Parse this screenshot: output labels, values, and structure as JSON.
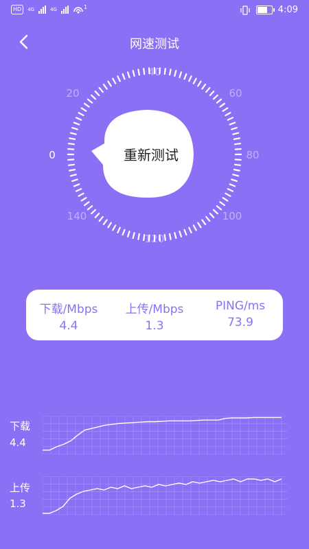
{
  "status": {
    "left_chip": "HD",
    "net1": "4G",
    "net2": "4G",
    "wifi_sup": "1",
    "time": "4:09"
  },
  "header": {
    "title": "网速测试"
  },
  "gauge": {
    "ticks": [
      "0",
      "20",
      "40",
      "60",
      "80",
      "100",
      "120",
      "140"
    ],
    "button_label": "重新测试"
  },
  "results": {
    "download": {
      "label": "下载/Mbps",
      "value": "4.4"
    },
    "upload": {
      "label": "上传/Mbps",
      "value": "1.3"
    },
    "ping": {
      "label": "PING/ms",
      "value": "73.9"
    }
  },
  "charts": {
    "download": {
      "label": "下载",
      "value": "4.4"
    },
    "upload": {
      "label": "上传",
      "value": "1.3"
    }
  },
  "chart_data": [
    {
      "type": "line",
      "name": "download",
      "values": [
        0.5,
        0.5,
        0.9,
        1.2,
        1.6,
        2.3,
        2.9,
        3.1,
        3.3,
        3.5,
        3.6,
        3.7,
        3.75,
        3.8,
        3.85,
        3.9,
        3.9,
        3.95,
        4.0,
        4.0,
        4.0,
        4.0,
        4.05,
        4.1,
        4.1,
        4.1,
        4.3,
        4.35,
        4.35,
        4.35,
        4.4,
        4.4,
        4.4,
        4.4,
        4.4
      ],
      "ylim": [
        0,
        4.6
      ]
    },
    {
      "type": "line",
      "name": "upload",
      "values": [
        0.05,
        0.05,
        0.15,
        0.3,
        0.6,
        0.75,
        0.85,
        0.9,
        0.95,
        0.9,
        1.0,
        0.95,
        1.05,
        0.95,
        1.0,
        1.05,
        1.0,
        1.1,
        1.05,
        1.1,
        1.15,
        1.1,
        1.2,
        1.15,
        1.2,
        1.25,
        1.2,
        1.25,
        1.3,
        1.2,
        1.3,
        1.3,
        1.25,
        1.3,
        1.2,
        1.3
      ],
      "ylim": [
        0,
        1.4
      ]
    }
  ],
  "colors": {
    "background": "#8b70f5",
    "card": "#ffffff",
    "accent": "#8b70f5"
  }
}
